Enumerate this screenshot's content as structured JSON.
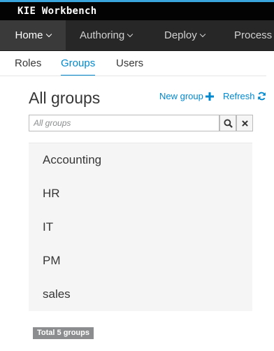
{
  "app": {
    "title": "KIE Workbench"
  },
  "nav": {
    "items": [
      {
        "label": "Home",
        "active": true
      },
      {
        "label": "Authoring",
        "active": false
      },
      {
        "label": "Deploy",
        "active": false
      },
      {
        "label": "Process M",
        "active": false
      }
    ]
  },
  "tabs": [
    {
      "label": "Roles",
      "active": false
    },
    {
      "label": "Groups",
      "active": true
    },
    {
      "label": "Users",
      "active": false
    }
  ],
  "page": {
    "title": "All groups",
    "new_group_label": "New group",
    "refresh_label": "Refresh"
  },
  "search": {
    "placeholder": "All groups",
    "value": ""
  },
  "groups": [
    "Accounting",
    "HR",
    "IT",
    "PM",
    "sales"
  ],
  "footer": {
    "total_label": "Total 5 groups"
  },
  "colors": {
    "accent": "#0088ce",
    "brand_bar": "#030303",
    "nav_bg": "#272727",
    "top_border": "#39a5dc"
  },
  "icons": {
    "new_group": "plus-icon",
    "refresh": "refresh-icon",
    "search": "search-icon",
    "clear": "close-icon",
    "nav_caret": "chevron-down-icon"
  }
}
